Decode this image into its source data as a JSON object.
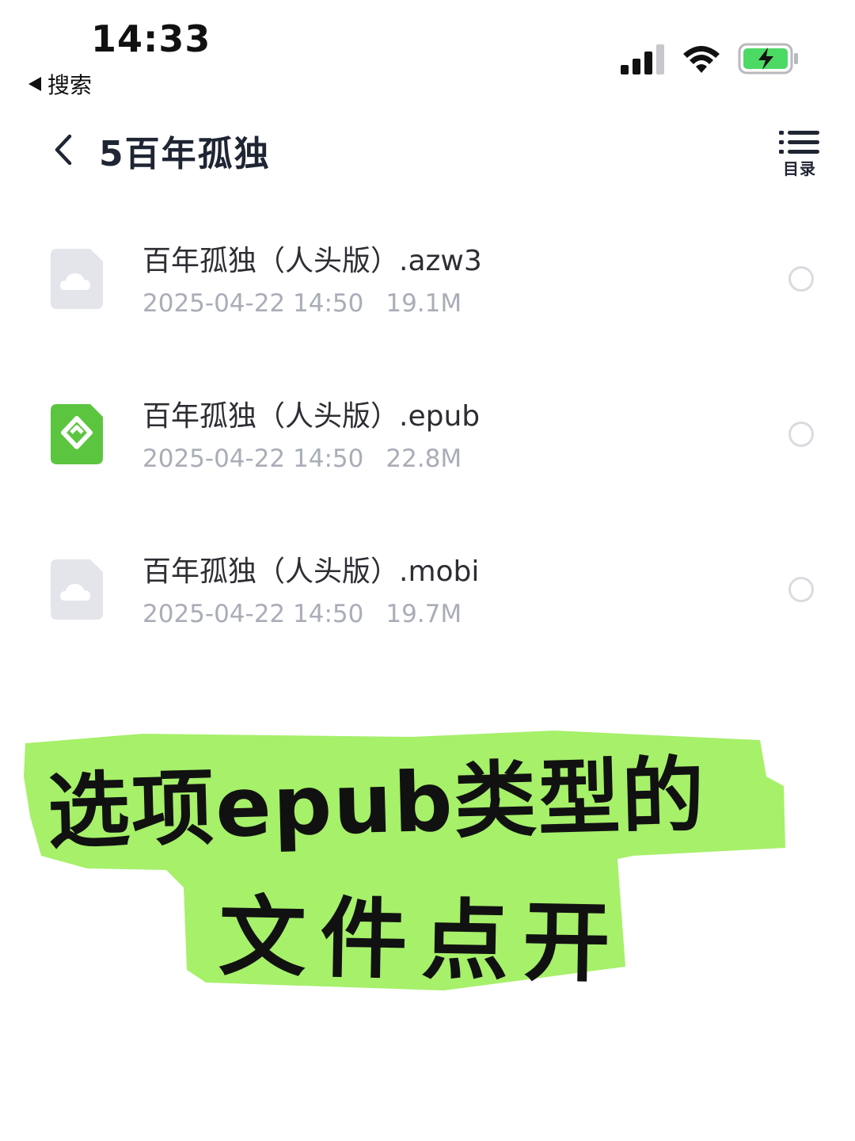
{
  "status_bar": {
    "time": "14:33",
    "back_label": "搜索"
  },
  "header": {
    "title": "5百年孤独",
    "toc_label": "目录"
  },
  "files": [
    {
      "name": "百年孤独（人头版）.azw3",
      "date": "2025-04-22 14:50",
      "size": "19.1M",
      "icon": "cloud-file-icon",
      "selected": false
    },
    {
      "name": "百年孤独（人头版）.epub",
      "date": "2025-04-22 14:50",
      "size": "22.8M",
      "icon": "epub-file-icon",
      "selected": false
    },
    {
      "name": "百年孤独（人头版）.mobi",
      "date": "2025-04-22 14:50",
      "size": "19.7M",
      "icon": "cloud-file-icon",
      "selected": false
    }
  ],
  "overlay": {
    "line1": "选项epub类型的",
    "line2": "文件点开",
    "highlight_color": "#a6f06a"
  },
  "colors": {
    "epub_green": "#5cc540",
    "cloud_gray": "#e3e5ea",
    "meta_gray": "#a9adb7",
    "battery_green": "#4cd964"
  }
}
